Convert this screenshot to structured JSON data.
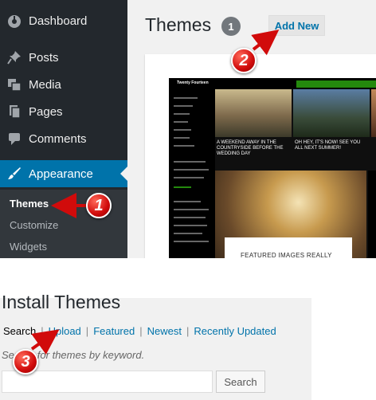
{
  "sidebar": {
    "items": [
      {
        "label": "Dashboard",
        "icon": "dashboard-icon"
      },
      {
        "label": "Posts",
        "icon": "pin-icon"
      },
      {
        "label": "Media",
        "icon": "media-icon"
      },
      {
        "label": "Pages",
        "icon": "pages-icon"
      },
      {
        "label": "Comments",
        "icon": "comment-icon"
      },
      {
        "label": "Appearance",
        "icon": "paintbrush-icon"
      }
    ],
    "submenu": [
      {
        "label": "Themes"
      },
      {
        "label": "Customize"
      },
      {
        "label": "Widgets"
      }
    ]
  },
  "themes": {
    "title": "Themes",
    "count": "1",
    "add_new_label": "Add New"
  },
  "theme_screenshot": {
    "site_title": "Twenty Fourteen",
    "caption_1": "A WEEKEND AWAY IN THE COUNTRYSIDE BEFORE THE WEDDING DAY",
    "caption_2": "OH HEY, IT'S NOW! SEE YOU ALL NEXT SUMMER!",
    "feature_title": "FEATURED IMAGES REALLY"
  },
  "install": {
    "title": "Install Themes",
    "tabs": [
      "Search",
      "Upload",
      "Featured",
      "Newest",
      "Recently Updated"
    ],
    "search_hint": "Search for themes by keyword.",
    "search_button": "Search"
  },
  "callouts": [
    "1",
    "2",
    "3"
  ],
  "colors": {
    "sidebar_bg": "#23282d",
    "active_menu": "#0073aa",
    "link": "#0073aa",
    "callout": "#d10b0b"
  }
}
